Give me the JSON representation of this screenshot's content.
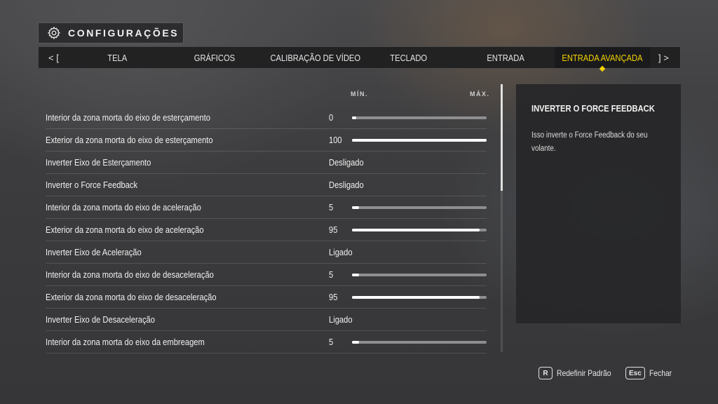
{
  "header": {
    "title": "CONFIGURAÇÕES",
    "icon": "gear-icon"
  },
  "tabs": {
    "prev": "< [",
    "next": "] >",
    "items": [
      {
        "label": "TELA",
        "active": false
      },
      {
        "label": "GRÁFICOS",
        "active": false
      },
      {
        "label": "CALIBRAÇÃO DE VÍDEO",
        "active": false
      },
      {
        "label": "TECLADO",
        "active": false
      },
      {
        "label": "ENTRADA",
        "active": false
      },
      {
        "label": "ENTRADA AVANÇADA",
        "active": true
      }
    ]
  },
  "scale": {
    "min": "MÍN.",
    "max": "MÁX."
  },
  "settings": [
    {
      "label": "Interior da zona morta do eixo de esterçamento",
      "value": "0",
      "slider": 0
    },
    {
      "label": "Exterior da zona morta do eixo de esterçamento",
      "value": "100",
      "slider": 100
    },
    {
      "label": "Inverter Eixo de Esterçamento",
      "value": "Desligado"
    },
    {
      "label": "Inverter o Force Feedback",
      "value": "Desligado"
    },
    {
      "label": "Interior da zona morta do eixo de aceleração",
      "value": "5",
      "slider": 5
    },
    {
      "label": "Exterior da zona morta do eixo de aceleração",
      "value": "95",
      "slider": 95
    },
    {
      "label": "Inverter Eixo de Aceleração",
      "value": "Ligado"
    },
    {
      "label": "Interior da zona morta do eixo de desaceleração",
      "value": "5",
      "slider": 5
    },
    {
      "label": "Exterior da zona morta do eixo de desaceleração",
      "value": "95",
      "slider": 95
    },
    {
      "label": "Inverter Eixo de Desaceleração",
      "value": "Ligado"
    },
    {
      "label": "Interior da zona morta do eixo da embreagem",
      "value": "5",
      "slider": 5
    }
  ],
  "info": {
    "title": "INVERTER O FORCE FEEDBACK",
    "description": "Isso inverte o Force Feedback do seu volante."
  },
  "footer": {
    "reset_key": "R",
    "reset_label": "Redefinir Padrão",
    "close_key": "Esc",
    "close_label": "Fechar"
  }
}
